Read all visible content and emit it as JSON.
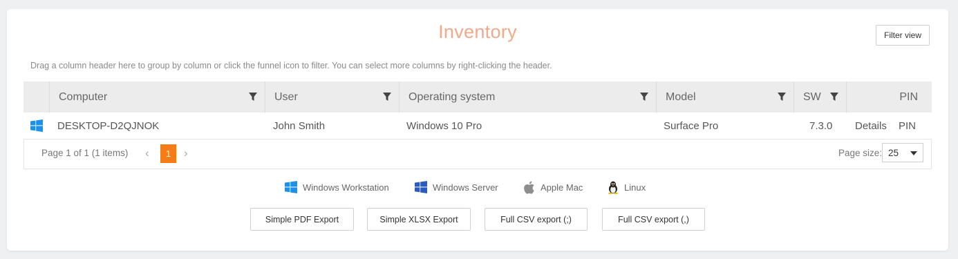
{
  "page": {
    "title": "Inventory",
    "filter_view_label": "Filter view",
    "hint": "Drag a column header here to group by column or click the funnel icon to filter. You can select more columns by right-clicking the header."
  },
  "grid": {
    "columns": [
      "Computer",
      "User",
      "Operating system",
      "Model",
      "SW",
      "PIN"
    ],
    "rows": [
      {
        "os_icon": "windows-icon",
        "computer": "DESKTOP-D2QJNOK",
        "user": "John Smith",
        "os": "Windows 10 Pro",
        "model": "Surface Pro",
        "sw": "7.3.0",
        "details_link": "Details",
        "pin_link": "PIN"
      }
    ]
  },
  "pager": {
    "info": "Page 1 of 1 (1 items)",
    "current_page": "1",
    "page_size_label": "Page size:",
    "page_size": "25"
  },
  "legend": [
    {
      "icon": "windows-workstation-icon",
      "label": "Windows Workstation"
    },
    {
      "icon": "windows-server-icon",
      "label": "Windows Server"
    },
    {
      "icon": "apple-icon",
      "label": "Apple Mac"
    },
    {
      "icon": "linux-icon",
      "label": "Linux"
    }
  ],
  "exports": [
    "Simple PDF Export",
    "Simple XLSX Export",
    "Full CSV export (;)",
    "Full CSV export (,)"
  ],
  "colors": {
    "accent": "#f57c16",
    "link": "#f08a3c",
    "title": "#f0a98a",
    "windows_workstation": "#1e90e8",
    "windows_server": "#2b5bbf"
  }
}
